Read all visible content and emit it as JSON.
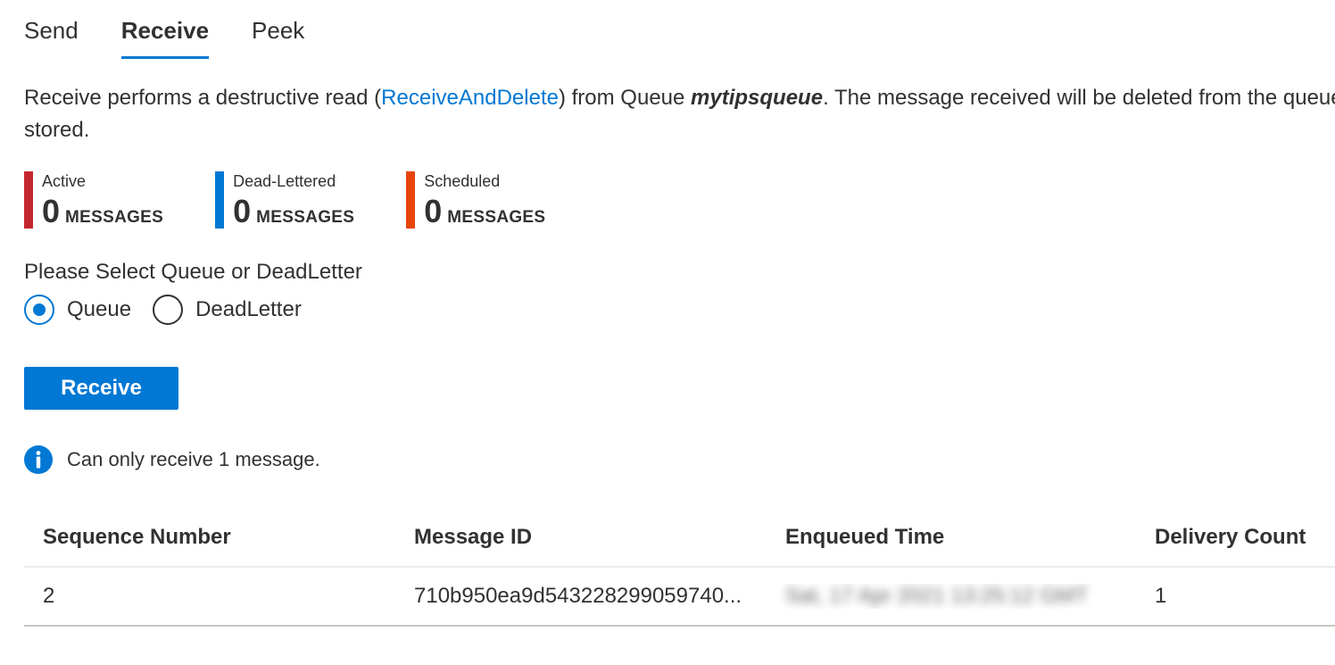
{
  "tabs": [
    {
      "label": "Send"
    },
    {
      "label": "Receive"
    },
    {
      "label": "Peek"
    }
  ],
  "active_tab": "Receive",
  "description": {
    "prefix": "Receive performs a destructive read (",
    "link": "ReceiveAndDelete",
    "middle": ") from Queue ",
    "queue_name": "mytipsqueue",
    "suffix": ". The message received will be deleted from the queue and will not be",
    "line2": "stored."
  },
  "counts": [
    {
      "label": "Active",
      "value": "0",
      "unit": "MESSAGES",
      "color": "#c4262e"
    },
    {
      "label": "Dead-Lettered",
      "value": "0",
      "unit": "MESSAGES",
      "color": "#0078d4"
    },
    {
      "label": "Scheduled",
      "value": "0",
      "unit": "MESSAGES",
      "color": "#e8450b"
    }
  ],
  "select": {
    "label": "Please Select Queue or DeadLetter",
    "options": [
      "Queue",
      "DeadLetter"
    ],
    "selected": "Queue"
  },
  "receive_button": "Receive",
  "info": {
    "text": "Can only receive 1 message."
  },
  "table": {
    "columns": [
      "Sequence Number",
      "Message ID",
      "Enqueued Time",
      "Delivery Count"
    ],
    "rows": [
      {
        "sequence_number": "2",
        "message_id": "710b950ea9d543228299059740...",
        "enqueued_time": "Sat, 17 Apr 2021 13:25:12 GMT",
        "delivery_count": "1"
      }
    ]
  },
  "colors": {
    "accent": "#0078d4",
    "text": "#323130"
  }
}
